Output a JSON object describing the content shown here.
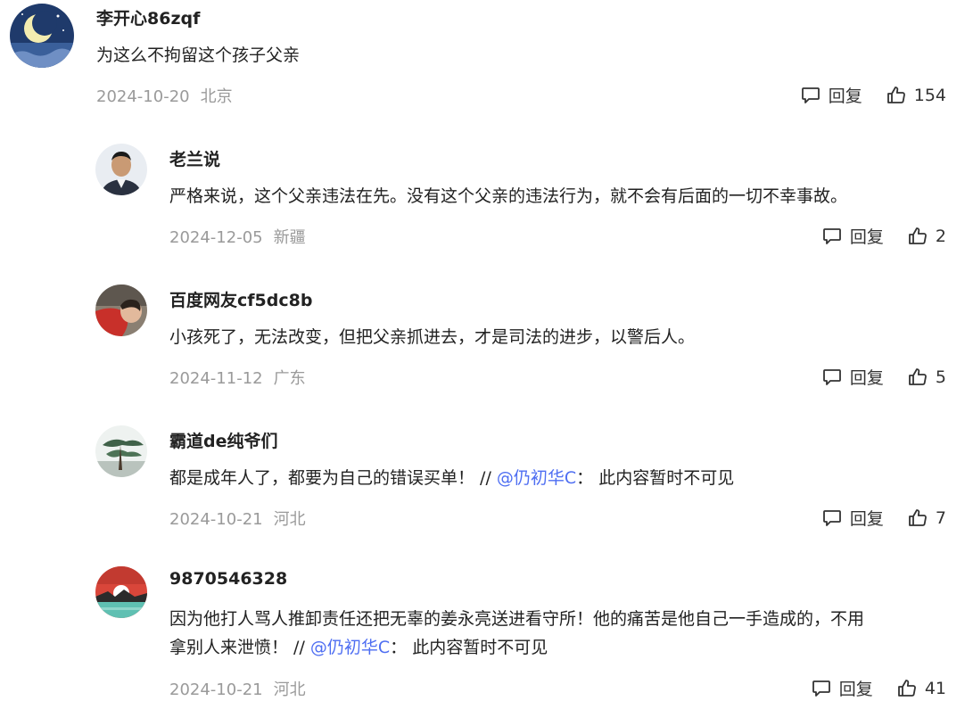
{
  "reply_label": "回复",
  "comments": [
    {
      "username": "李开心86zqf",
      "text": "为这么不拘留这个孩子父亲",
      "date": "2024-10-20",
      "location": "北京",
      "likes": "154",
      "avatar": "moon-night-avatar"
    },
    {
      "username": "老兰说",
      "text": "严格来说，这个父亲违法在先。没有这个父亲的违法行为，就不会有后面的一切不幸事故。",
      "date": "2024-12-05",
      "location": "新疆",
      "likes": "2",
      "avatar": "man-portrait-avatar"
    },
    {
      "username": "百度网友cf5dc8b",
      "text": "小孩死了，无法改变，但把父亲抓进去，才是司法的进步，以警后人。",
      "date": "2024-11-12",
      "location": "广东",
      "likes": "5",
      "avatar": "child-photo-avatar"
    },
    {
      "username": "霸道de纯爷们",
      "text": "都是成年人了，都要为自己的错误买单！ //",
      "mention": "@仍初华C",
      "after_mention": "：  此内容暂时不可见",
      "date": "2024-10-21",
      "location": "河北",
      "likes": "7",
      "avatar": "pine-tree-avatar"
    },
    {
      "username": "9870546328",
      "text_line1": "因为他打人骂人推卸责任还把无辜的姜永亮送进看守所！他的痛苦是他自己一手造成的，不用",
      "text_line2": "拿别人来泄愤！ //",
      "mention": "@仍初华C",
      "after_mention": "：  此内容暂时不可见",
      "date": "2024-10-21",
      "location": "河北",
      "likes": "41",
      "avatar": "sunset-sea-avatar"
    }
  ],
  "colors": {
    "mention": "#4e6ef2",
    "meta": "#9a9a9a",
    "text": "#222222"
  }
}
